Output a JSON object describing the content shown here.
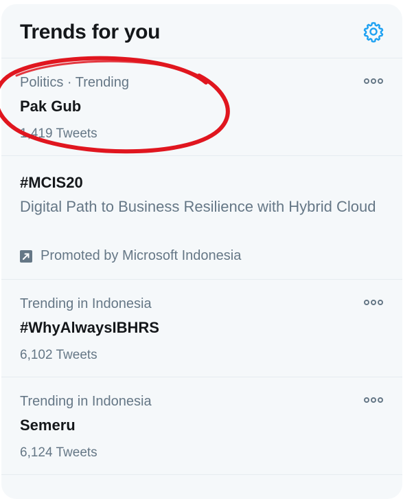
{
  "header": {
    "title": "Trends for you",
    "settings_icon": "gear-icon"
  },
  "trends": [
    {
      "context": "Politics · Trending",
      "name": "Pak Gub",
      "tweets": "1,419 Tweets",
      "more_icon": "more-options-icon"
    },
    {
      "name": "#MCIS20",
      "description": "Digital Path to Business Resilience with Hybrid Cloud",
      "promoted_by": "Promoted by Microsoft Indonesia",
      "promoted_icon": "promoted-icon"
    },
    {
      "context": "Trending in Indonesia",
      "name": "#WhyAlwaysIBHRS",
      "tweets": "6,102 Tweets",
      "more_icon": "more-options-icon"
    },
    {
      "context": "Trending in Indonesia",
      "name": "Semeru",
      "tweets": "6,124 Tweets",
      "more_icon": "more-options-icon"
    }
  ],
  "colors": {
    "accent": "#1da1f2",
    "annotation": "#e0161f",
    "panel_bg": "#f5f8fa",
    "primary_text": "#14171a",
    "secondary_text": "#657786"
  }
}
